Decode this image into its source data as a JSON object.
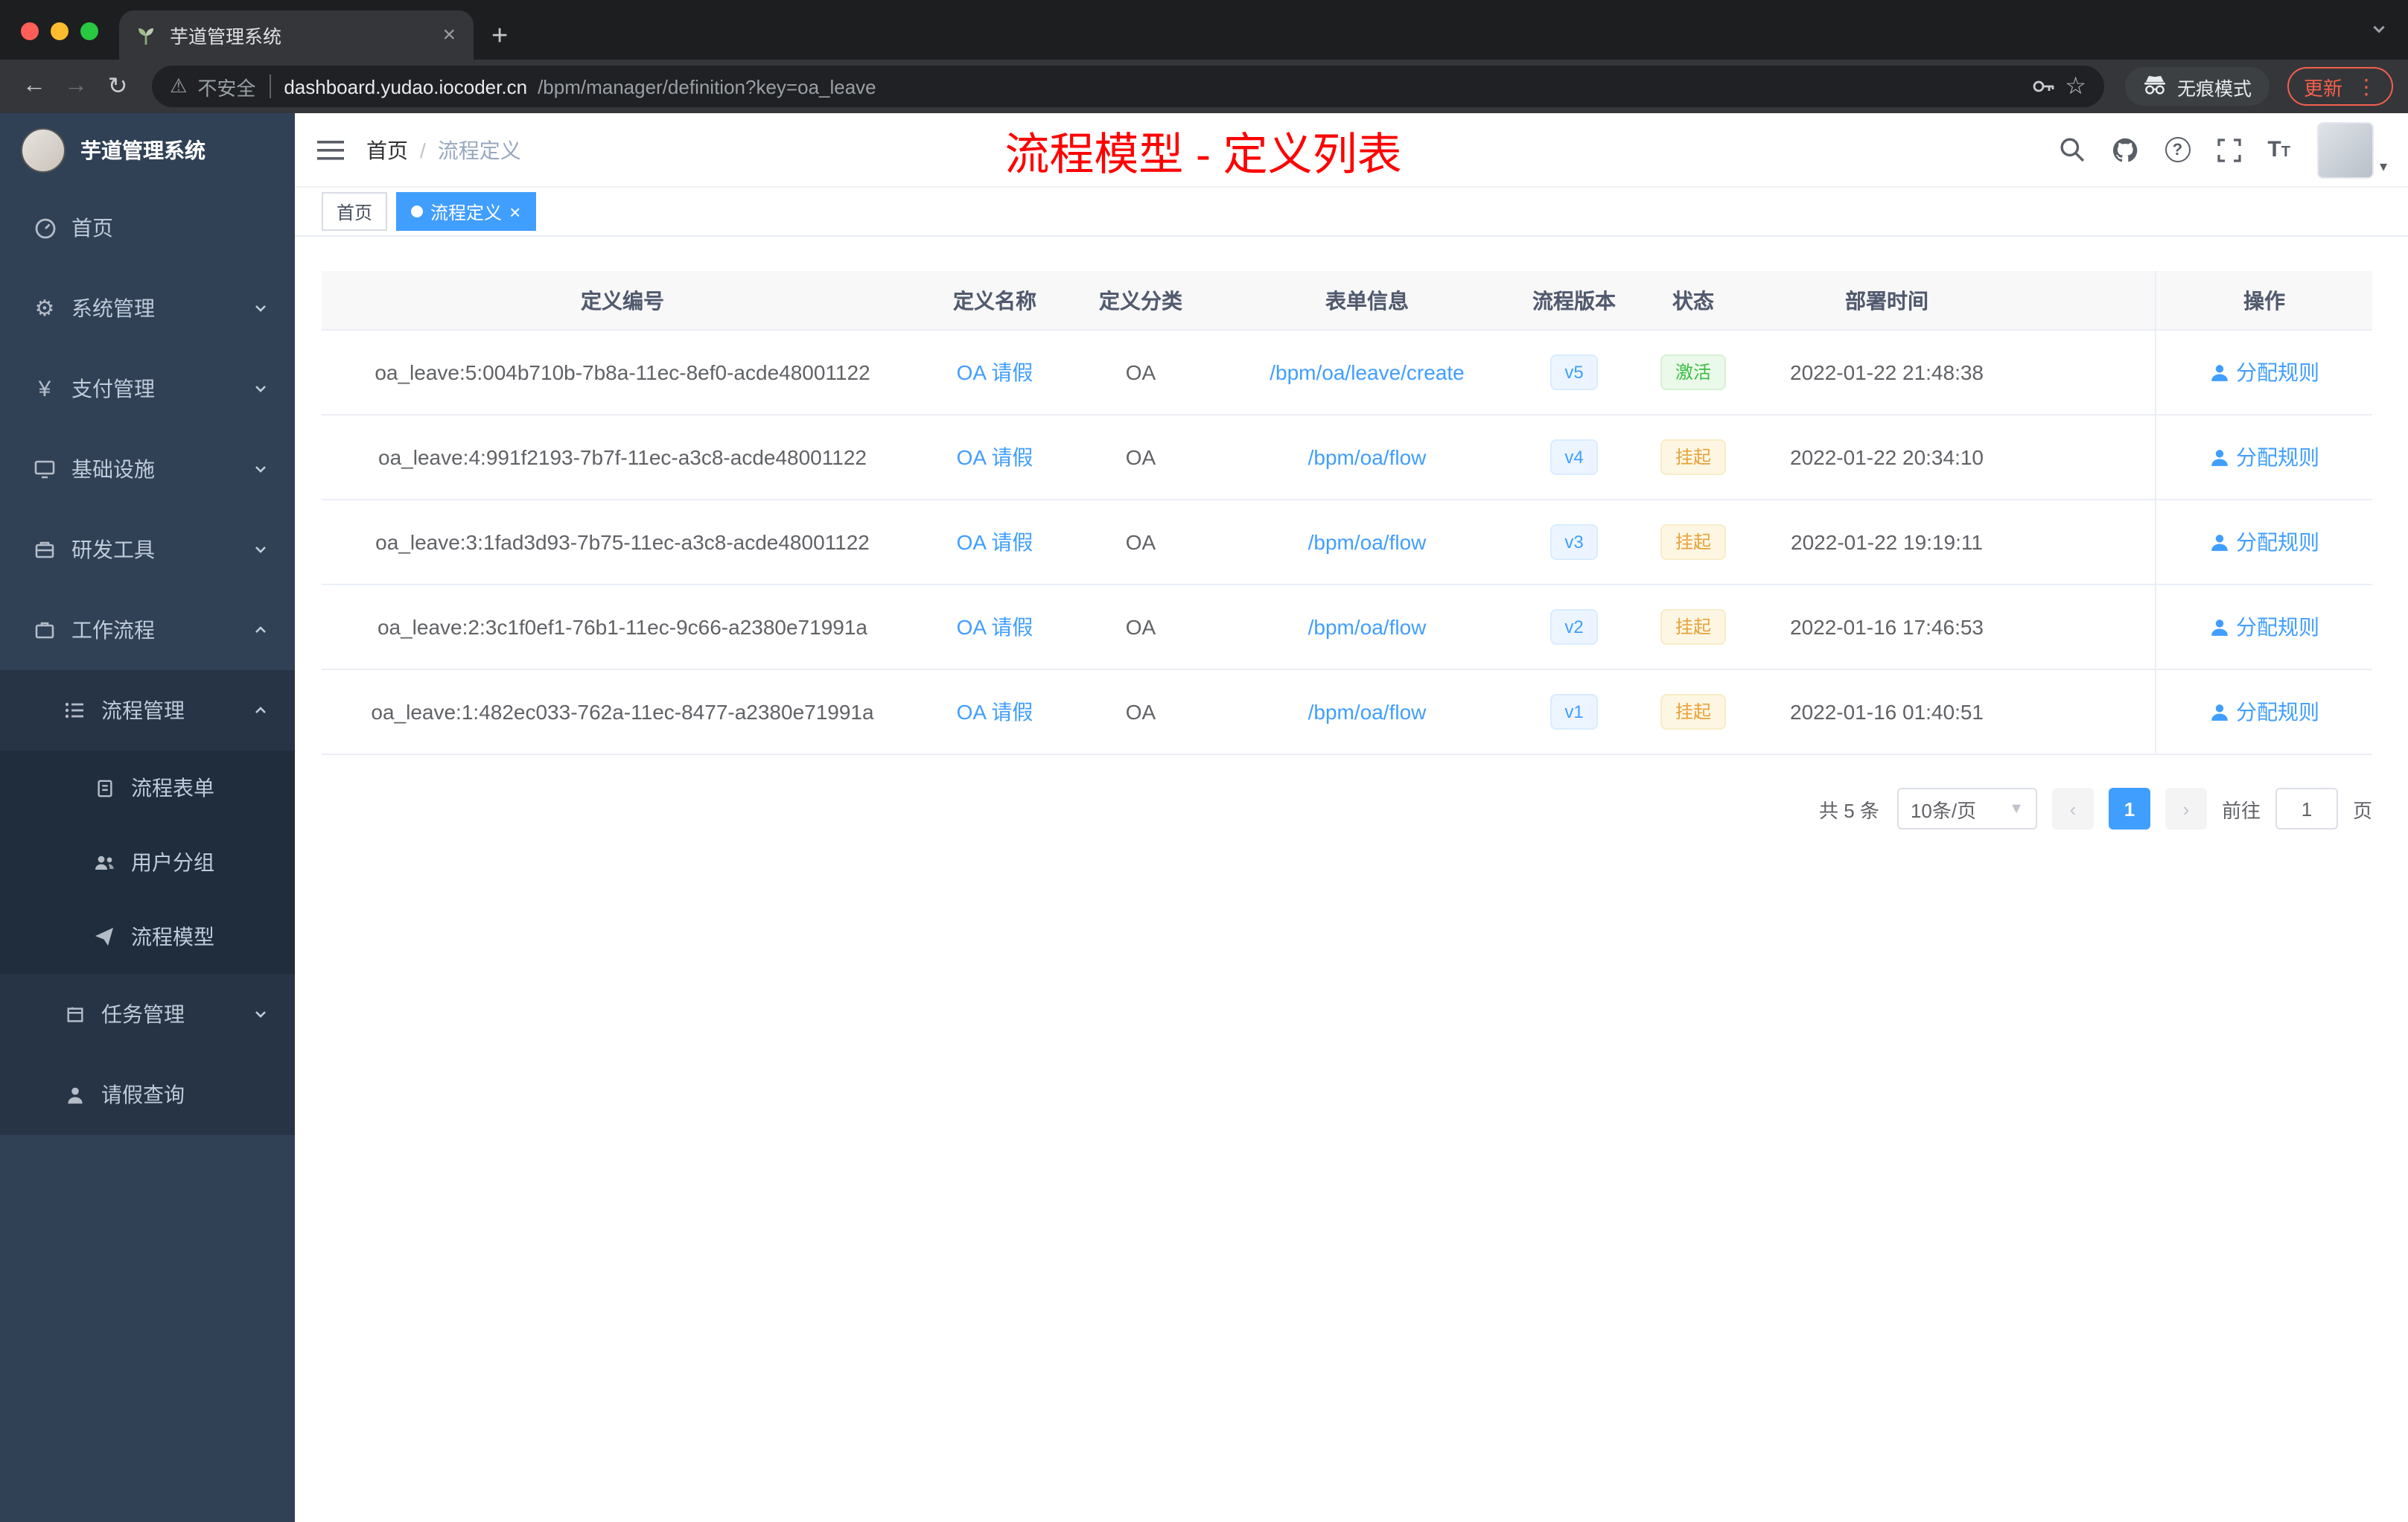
{
  "browser": {
    "tab_title": "芋道管理系统",
    "not_secure_label": "不安全",
    "url_host": "dashboard.yudao.iocoder.cn",
    "url_path": "/bpm/manager/definition?key=oa_leave",
    "incognito_label": "无痕模式",
    "update_label": "更新"
  },
  "sidebar": {
    "logo_title": "芋道管理系统",
    "items": [
      {
        "label": "首页"
      },
      {
        "label": "系统管理"
      },
      {
        "label": "支付管理"
      },
      {
        "label": "基础设施"
      },
      {
        "label": "研发工具"
      },
      {
        "label": "工作流程"
      },
      {
        "label": "流程管理"
      },
      {
        "label": "流程表单"
      },
      {
        "label": "用户分组"
      },
      {
        "label": "流程模型"
      },
      {
        "label": "任务管理"
      },
      {
        "label": "请假查询"
      }
    ]
  },
  "header": {
    "breadcrumb_home": "首页",
    "breadcrumb_current": "流程定义",
    "page_title": "流程模型 - 定义列表"
  },
  "tags_view": {
    "home_tag": "首页",
    "active_tag": "流程定义"
  },
  "table": {
    "columns": [
      "定义编号",
      "定义名称",
      "定义分类",
      "表单信息",
      "流程版本",
      "状态",
      "部署时间",
      "操作"
    ],
    "action_label": "分配规则",
    "rows": [
      {
        "id": "oa_leave:5:004b710b-7b8a-11ec-8ef0-acde48001122",
        "name": "OA 请假",
        "category": "OA",
        "form": "/bpm/oa/leave/create",
        "version": "v5",
        "status": "激活",
        "status_type": "success",
        "time": "2022-01-22 21:48:38"
      },
      {
        "id": "oa_leave:4:991f2193-7b7f-11ec-a3c8-acde48001122",
        "name": "OA 请假",
        "category": "OA",
        "form": "/bpm/oa/flow",
        "version": "v4",
        "status": "挂起",
        "status_type": "warning",
        "time": "2022-01-22 20:34:10"
      },
      {
        "id": "oa_leave:3:1fad3d93-7b75-11ec-a3c8-acde48001122",
        "name": "OA 请假",
        "category": "OA",
        "form": "/bpm/oa/flow",
        "version": "v3",
        "status": "挂起",
        "status_type": "warning",
        "time": "2022-01-22 19:19:11"
      },
      {
        "id": "oa_leave:2:3c1f0ef1-76b1-11ec-9c66-a2380e71991a",
        "name": "OA 请假",
        "category": "OA",
        "form": "/bpm/oa/flow",
        "version": "v2",
        "status": "挂起",
        "status_type": "warning",
        "time": "2022-01-16 17:46:53"
      },
      {
        "id": "oa_leave:1:482ec033-762a-11ec-8477-a2380e71991a",
        "name": "OA 请假",
        "category": "OA",
        "form": "/bpm/oa/flow",
        "version": "v1",
        "status": "挂起",
        "status_type": "warning",
        "time": "2022-01-16 01:40:51"
      }
    ]
  },
  "pagination": {
    "total": "共 5 条",
    "page_size": "10条/页",
    "current_page": "1",
    "goto_label": "前往",
    "goto_value": "1",
    "page_unit": "页"
  },
  "colors": {
    "primary": "#409eff",
    "title_red": "#ff0000",
    "success_green": "#67c23a",
    "warning_orange": "#e6a23c",
    "sidebar_bg": "#304156"
  }
}
